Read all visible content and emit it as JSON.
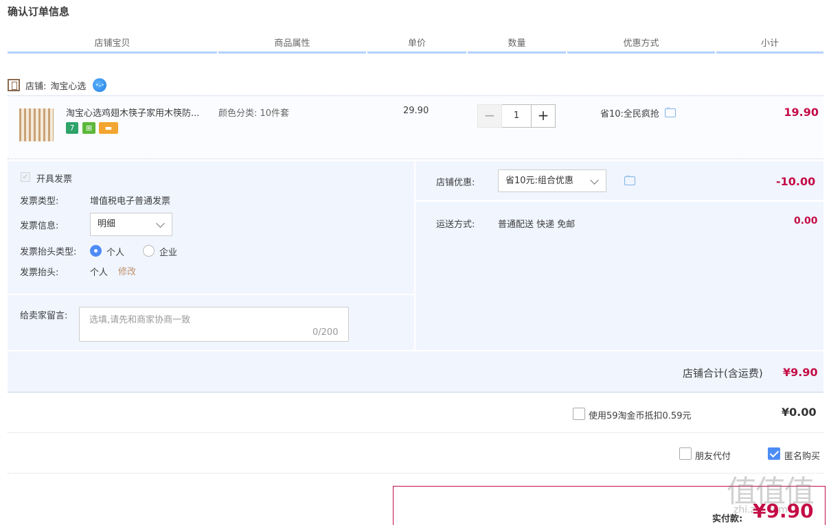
{
  "page": {
    "title": "确认订单信息"
  },
  "columns": [
    "店铺宝贝",
    "商品属性",
    "单价",
    "数量",
    "优惠方式",
    "小计"
  ],
  "shop": {
    "label": "店铺:",
    "name": "淘宝心选"
  },
  "item": {
    "title": "淘宝心选鸡翅木筷子家用木筷防...",
    "badges": [
      "7",
      "⊞",
      "▬"
    ],
    "attribute": "颜色分类:  10件套",
    "unit_price": "29.90",
    "quantity": "1",
    "minus": "−",
    "plus": "+",
    "promotion": "省10:全民疯抢",
    "subtotal": "19.90"
  },
  "invoice": {
    "checkbox_label": "开具发票",
    "type_label": "发票类型:",
    "type_value": "增值税电子普通发票",
    "info_label": "发票信息:",
    "info_value": "明细",
    "header_type_label": "发票抬头类型:",
    "options": [
      "个人",
      "企业"
    ],
    "selected_option": "个人",
    "header_label": "发票抬头:",
    "header_value": "个人",
    "edit_link": "修改"
  },
  "message": {
    "label": "给卖家留言:",
    "placeholder": "选填,请先和商家协商一致",
    "counter": "0/200"
  },
  "shop_discount": {
    "label": "店铺优惠:",
    "value": "省10元:组合优惠",
    "amount": "-10.00"
  },
  "shipping": {
    "label": "运送方式:",
    "value": "普通配送 快递 免邮",
    "amount": "0.00"
  },
  "shop_total": {
    "label": "店铺合计(含运费)",
    "value": "¥9.90"
  },
  "coins": {
    "label": "使用59淘金币抵扣0.59元",
    "value": "¥0.00",
    "checked": false
  },
  "options_row": {
    "friend_pay": "朋友代付",
    "anonymous": "匿名购买",
    "friend_pay_checked": false,
    "anonymous_checked": true
  },
  "payment": {
    "label": "实付款:",
    "value": "¥9.90"
  },
  "watermark": {
    "big": "值值值",
    "small": "zhi.zhi.com"
  },
  "colors": {
    "accent": "#4d8cf5",
    "price_red": "#c40d46",
    "panel_bg": "#f0f5fe",
    "header_underline": "#b2d1ff"
  }
}
